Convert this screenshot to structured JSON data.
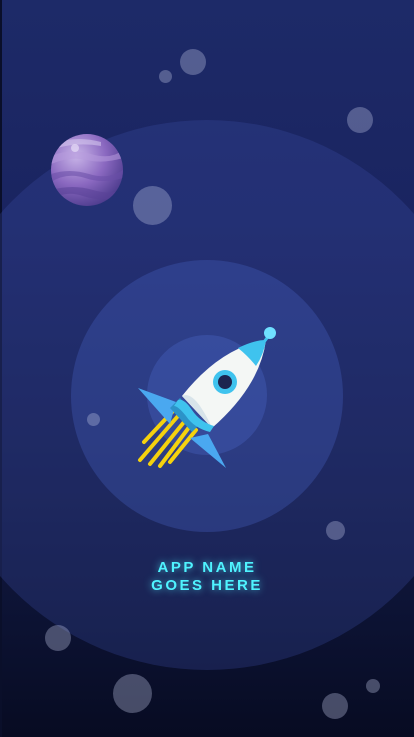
{
  "splash": {
    "app_name_line1": "APP NAME",
    "app_name_line2": "GOES HERE"
  },
  "colors": {
    "background_top": "#1d2a68",
    "background_bottom": "#070b22",
    "accent_text": "#4ff3ff",
    "rocket_body": "#f4f7f5",
    "rocket_accent": "#3fc3ee",
    "rocket_flame": "#f5d20e",
    "planet": "#8a68c0"
  },
  "icons": {
    "rocket": "rocket-icon",
    "planet": "planet-icon"
  }
}
